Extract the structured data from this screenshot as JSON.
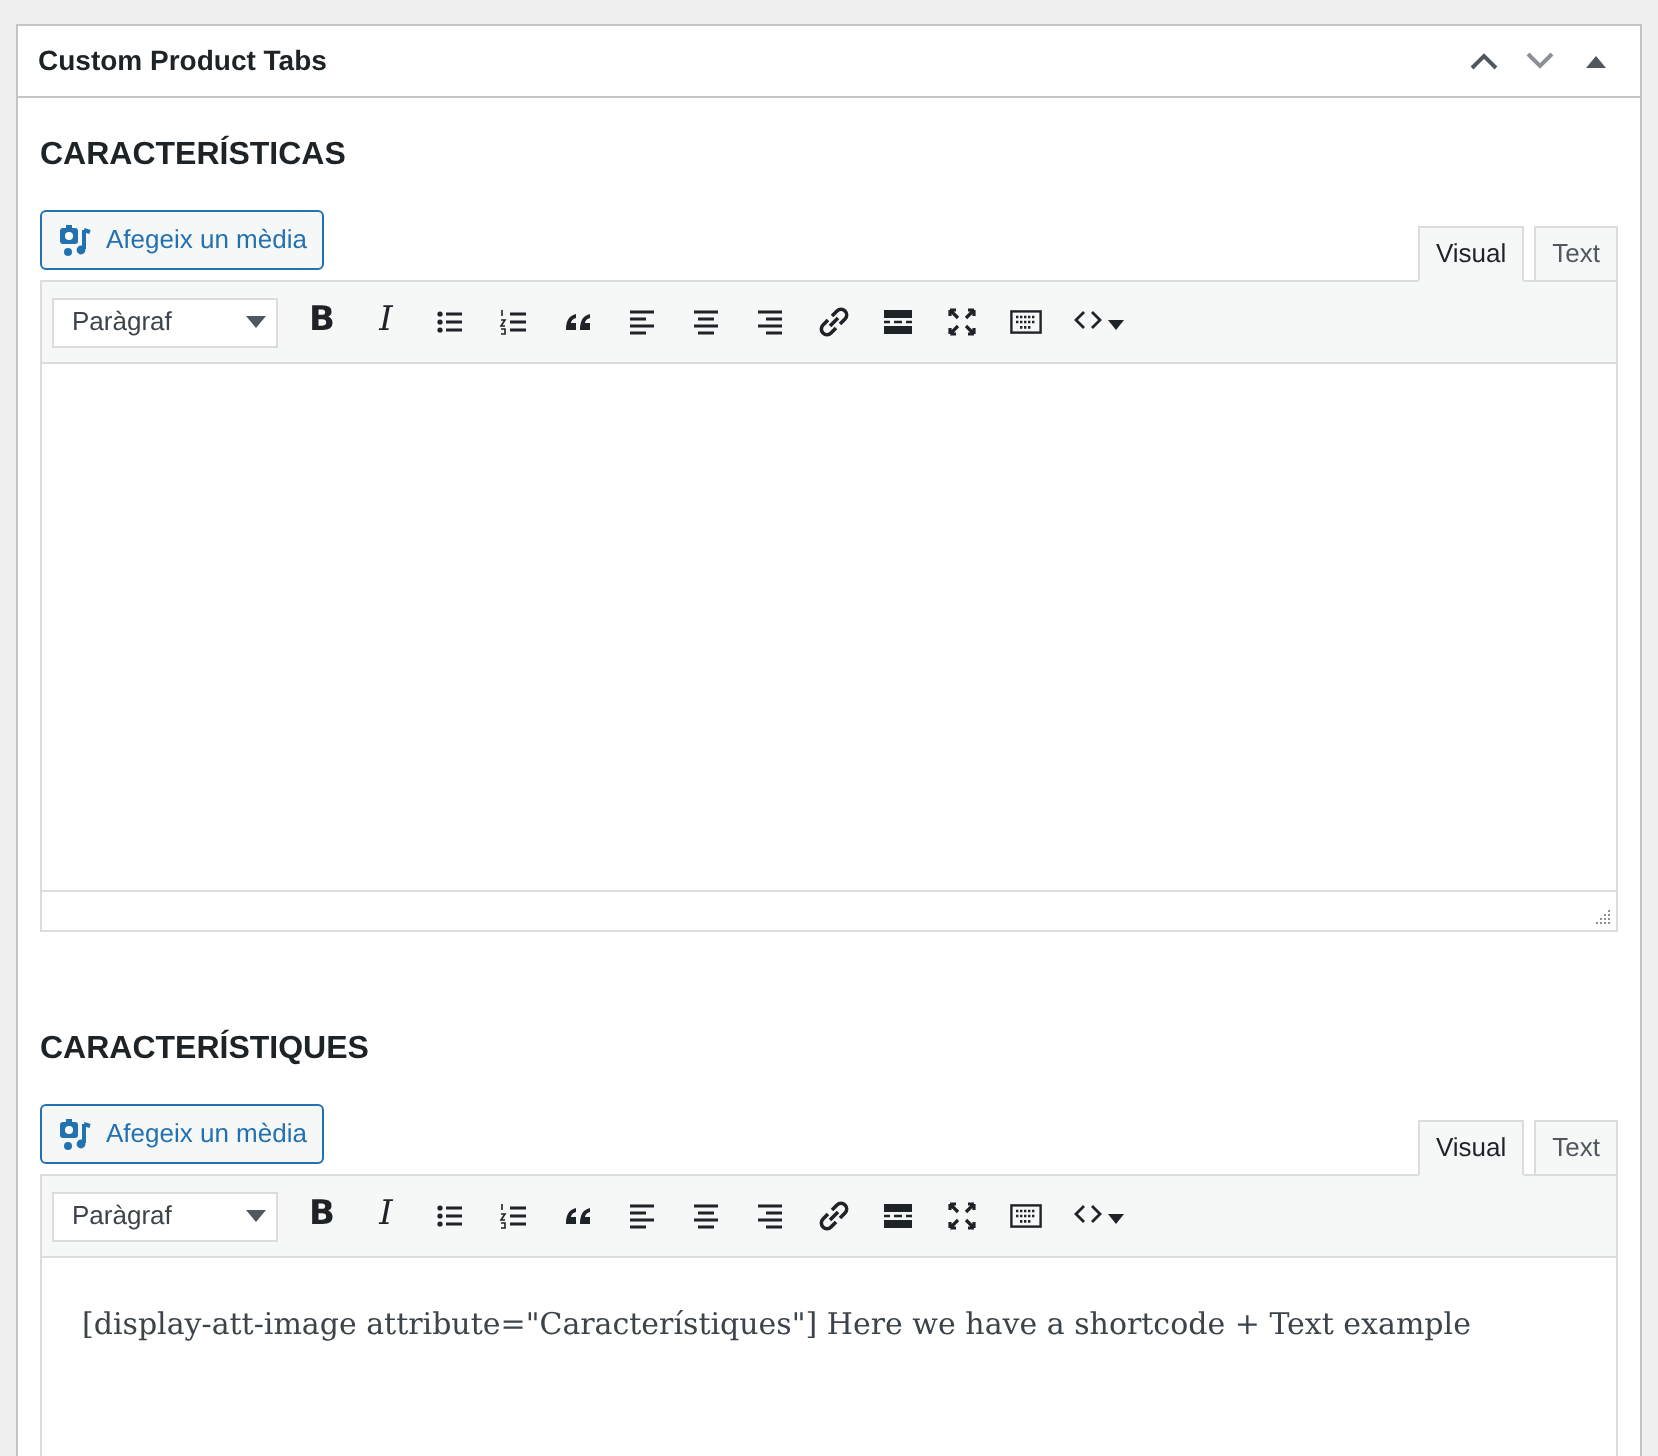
{
  "panel": {
    "title": "Custom Product Tabs"
  },
  "editors": [
    {
      "heading": "CARACTERÍSTICAS",
      "media_button": "Afegeix un mèdia",
      "tabs": [
        {
          "label": "Visual",
          "selected": true
        },
        {
          "label": "Text",
          "selected": false
        }
      ],
      "format": "Paràgraf",
      "bold_label": "B",
      "italic_label": "I",
      "status_bar": true
    },
    {
      "heading": "CARACTERÍSTIQUES",
      "media_button": "Afegeix un mèdia",
      "tabs": [
        {
          "label": "Visual",
          "selected": true
        },
        {
          "label": "Text",
          "selected": false
        }
      ],
      "format": "Paràgraf",
      "bold_label": "B",
      "italic_label": "I",
      "content": "[display-att-image attribute=\"Característiques\"] Here we have a shortcode + Text example"
    }
  ]
}
